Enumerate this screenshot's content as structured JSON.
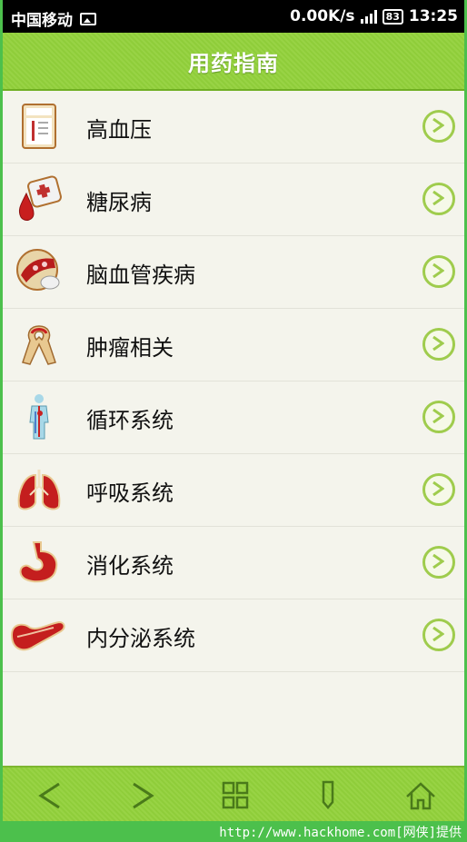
{
  "status_bar": {
    "carrier": "中国移动",
    "speed": "0.00K/s",
    "battery": "83",
    "time": "13:25"
  },
  "header": {
    "title": "用药指南"
  },
  "list": {
    "items": [
      {
        "label": "高血压",
        "icon": "blood-pressure-chart-icon"
      },
      {
        "label": "糖尿病",
        "icon": "blood-drop-glucose-icon"
      },
      {
        "label": "脑血管疾病",
        "icon": "blood-vessel-icon"
      },
      {
        "label": "肿瘤相关",
        "icon": "awareness-ribbon-icon"
      },
      {
        "label": "循环系统",
        "icon": "circulatory-body-icon"
      },
      {
        "label": "呼吸系统",
        "icon": "lungs-icon"
      },
      {
        "label": "消化系统",
        "icon": "stomach-icon"
      },
      {
        "label": "内分泌系统",
        "icon": "pancreas-icon"
      }
    ]
  },
  "toolbar": {
    "buttons": [
      "back-icon",
      "forward-icon",
      "grid-menu-icon",
      "bookmark-icon",
      "home-icon"
    ]
  },
  "watermark": {
    "text": "http://www.hackhome.com[网侠]提供"
  }
}
